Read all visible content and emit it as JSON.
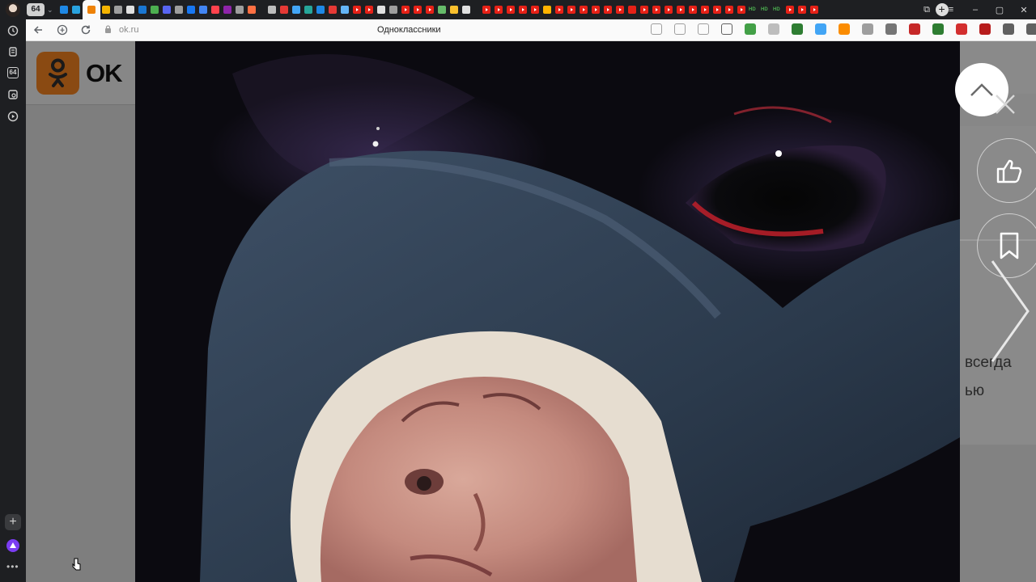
{
  "window": {
    "tab_counter": "64",
    "new_tab_label": "+",
    "controls": {
      "restore": "⧉",
      "menu": "≡",
      "minimize": "–",
      "maximize": "▢",
      "close": "✕"
    }
  },
  "tabs": [
    {
      "icon": "messenger-icon",
      "color": "#1e88e5"
    },
    {
      "icon": "telegram-icon",
      "color": "#29a3df"
    },
    {
      "icon": "odnoklassniki-icon",
      "color": "#ee8208",
      "active": true
    },
    {
      "icon": "mail-icon",
      "color": "#f4b400"
    },
    {
      "icon": "page-icon",
      "color": "#9e9e9e"
    },
    {
      "icon": "chrome-icon",
      "color": "#e0e0e0"
    },
    {
      "icon": "mail-icon",
      "color": "#1976d2"
    },
    {
      "icon": "maps-icon",
      "color": "#4caf50"
    },
    {
      "icon": "discord-icon",
      "color": "#5865f2"
    },
    {
      "icon": "page-icon",
      "color": "#9e9e9e"
    },
    {
      "icon": "facebook-icon",
      "color": "#1877f2"
    },
    {
      "icon": "translate-icon",
      "color": "#4285f4"
    },
    {
      "icon": "patreon-icon",
      "color": "#ff424d"
    },
    {
      "icon": "music-icon",
      "color": "#8e24aa"
    },
    {
      "icon": "page-icon",
      "color": "#9e9e9e"
    },
    {
      "icon": "diamond-icon",
      "color": "#ff7043"
    }
  ],
  "tabs_group2": [
    {
      "icon": "back-arrow-icon",
      "color": "#bdbdbd"
    },
    {
      "icon": "c-icon",
      "color": "#e53935"
    },
    {
      "icon": "c-icon",
      "color": "#42a5f5"
    },
    {
      "icon": "c-icon",
      "color": "#26a69a"
    },
    {
      "icon": "a-icon",
      "color": "#1e88e5"
    },
    {
      "icon": "circle-icon",
      "color": "#e53935"
    },
    {
      "icon": "cloud-icon",
      "color": "#64b5f6"
    },
    {
      "icon": "youtube-icon",
      "color": "#e62117"
    },
    {
      "icon": "youtube-icon",
      "color": "#e62117"
    },
    {
      "icon": "shield-icon",
      "color": "#e0e0e0"
    },
    {
      "icon": "page-icon",
      "color": "#9e9e9e"
    },
    {
      "icon": "youtube-icon",
      "color": "#e62117"
    },
    {
      "icon": "youtube-icon",
      "color": "#e62117"
    },
    {
      "icon": "youtube-icon",
      "color": "#e62117"
    },
    {
      "icon": "colorful-icon",
      "color": "#66bb6a"
    },
    {
      "icon": "crown-icon",
      "color": "#fbc02d"
    },
    {
      "icon": "a-icon",
      "color": "#e0e0e0"
    }
  ],
  "tabs_group3_count": 22,
  "hd_tabs": [
    "HD",
    "HD",
    "HD"
  ],
  "side_panel": {
    "icons": [
      "clock-icon",
      "collections-icon",
      "counter-icon",
      "screenshot-icon",
      "play-icon"
    ],
    "counter_label": "64",
    "add_label": "+",
    "more_label": "•••"
  },
  "address_bar": {
    "url": "ok.ru",
    "page_title": "Одноклассники",
    "extensions": [
      {
        "icon": "translate-page-icon",
        "color": "#9e9e9e"
      },
      {
        "icon": "search-icon",
        "color": "#9e9e9e"
      },
      {
        "icon": "reader-icon",
        "color": "#9e9e9e"
      },
      {
        "icon": "bookmark-icon",
        "color": "#616161"
      },
      {
        "icon": "extension-green-icon",
        "color": "#43a047"
      },
      {
        "icon": "diamond-extension-icon",
        "color": "#bdbdbd"
      },
      {
        "icon": "kaspersky-icon",
        "color": "#2e7d32"
      },
      {
        "icon": "cloud-extension-icon",
        "color": "#42a5f5"
      },
      {
        "icon": "ghostery-icon",
        "color": "#fb8c00"
      },
      {
        "icon": "globe-icon",
        "color": "#9e9e9e"
      },
      {
        "icon": "vpn-icon",
        "color": "#757575"
      },
      {
        "icon": "download-red-icon",
        "color": "#c62828"
      },
      {
        "icon": "check-green-icon",
        "color": "#2e7d32"
      },
      {
        "icon": "adblock-icon",
        "color": "#d32f2f"
      },
      {
        "icon": "adguard-icon",
        "color": "#b71c1c"
      },
      {
        "icon": "puzzle-icon",
        "color": "#616161"
      },
      {
        "icon": "downloads-icon",
        "color": "#616161"
      }
    ]
  },
  "ok": {
    "logo_text": "OK",
    "brand_color": "#ee8208"
  },
  "background_text": {
    "line1": "всегда",
    "line2": "ью"
  },
  "viewer": {
    "accent": "#ffffff"
  }
}
